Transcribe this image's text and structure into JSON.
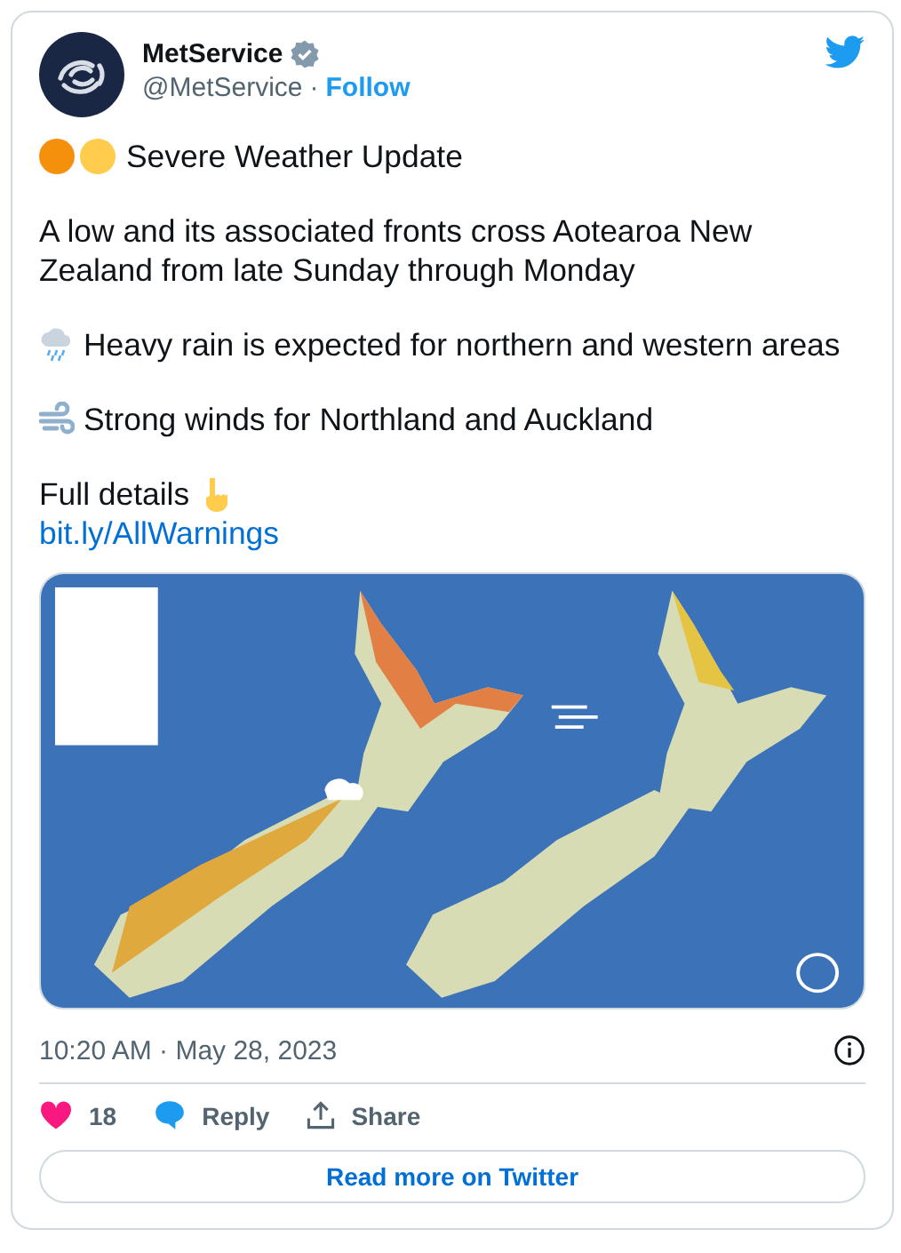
{
  "author": {
    "name": "MetService",
    "verified": true,
    "handle": "@MetService",
    "separator": "·",
    "follow": "Follow"
  },
  "paragraphs": [
    {
      "kind": "headline",
      "text": "Severe Weather Update"
    },
    {
      "kind": "plain",
      "text": "A low and its associated fronts cross Aotearoa New Zealand from late Sunday through Monday"
    },
    {
      "kind": "rain",
      "text": "Heavy rain is expected for northern and western areas"
    },
    {
      "kind": "wind",
      "text": "Strong winds for Northland and Auckland"
    },
    {
      "kind": "details",
      "text": "Full details",
      "link": "bit.ly/AllWarnings"
    }
  ],
  "timestamp": "10:20 AM · May 28, 2023",
  "actions": {
    "likes": "18",
    "reply": "Reply",
    "share": "Share"
  },
  "read_more": "Read more on Twitter"
}
